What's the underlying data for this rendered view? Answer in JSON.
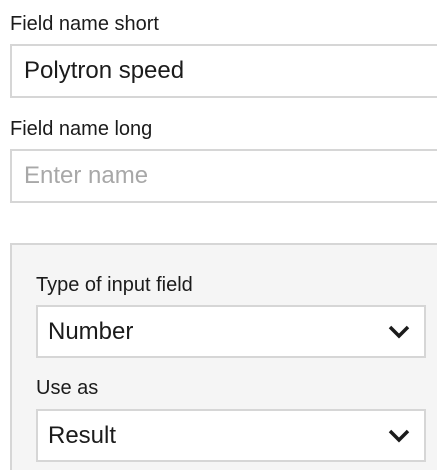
{
  "form": {
    "field_name_short": {
      "label": "Field name short",
      "value": "Polytron speed"
    },
    "field_name_long": {
      "label": "Field name long",
      "placeholder": "Enter name",
      "value": ""
    },
    "input_settings": {
      "type_of_input_field": {
        "label": "Type of input field",
        "selected": "Number"
      },
      "use_as": {
        "label": "Use as",
        "selected": "Result"
      }
    }
  },
  "icons": {
    "dropdown": "chevron-down-icon"
  },
  "colors": {
    "border": "#d6d6d6",
    "group_background": "#f5f5f5",
    "text": "#1b1b1b",
    "placeholder": "#a8a8a8"
  }
}
